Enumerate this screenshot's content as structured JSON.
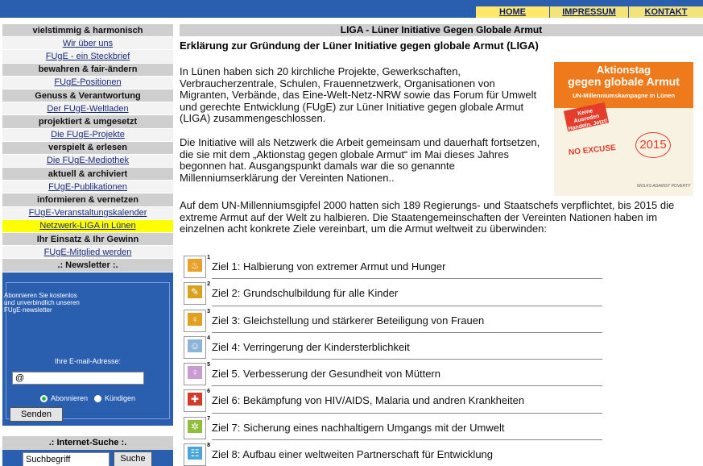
{
  "topnav": {
    "home": "HOME",
    "impressum": "IMPRESSUM",
    "kontakt": "KONTAKT"
  },
  "sidebar": {
    "items": [
      {
        "label": "vielstimmig & harmonisch",
        "kind": "category"
      },
      {
        "label": "Wir über uns",
        "kind": "link"
      },
      {
        "label": "FUgE - ein Steckbrief",
        "kind": "link"
      },
      {
        "label": "bewahren & fair-ändern",
        "kind": "category"
      },
      {
        "label": "FUgE-Positionen",
        "kind": "link"
      },
      {
        "label": "Genuss & Verantwortung",
        "kind": "category"
      },
      {
        "label": "Der FUgE-Weltladen",
        "kind": "link"
      },
      {
        "label": "projektiert & umgesetzt",
        "kind": "category"
      },
      {
        "label": "Die FUgE-Projekte",
        "kind": "link"
      },
      {
        "label": "verspielt & erlesen",
        "kind": "category"
      },
      {
        "label": "Die FUgE-Mediothek",
        "kind": "link"
      },
      {
        "label": "aktuell & archiviert",
        "kind": "category"
      },
      {
        "label": "FUgE-Publikationen",
        "kind": "link"
      },
      {
        "label": "informieren & vernetzen",
        "kind": "category"
      },
      {
        "label": "FUgE-Veranstaltungskalender",
        "kind": "link"
      },
      {
        "label": "Netzwerk-LIGA in Lünen",
        "kind": "active"
      },
      {
        "label": "Ihr Einsatz & Ihr Gewinn",
        "kind": "category"
      },
      {
        "label": "FUgE-Mitglied werden",
        "kind": "link"
      }
    ],
    "newsletter_heading": ".: Newsletter :.",
    "newsletter_intro": "Abonnieren Sie kostenlos\nund unverbindlich unseren\nFUgE-newsletter",
    "email_label": "Ihre E-mail-Adresse:",
    "email_value": "@",
    "radio_subscribe": "Abonnieren",
    "radio_unsubscribe": "Kündigen",
    "send_label": "Senden",
    "search_heading": ".: Internet-Suche :.",
    "search_value": "Suchbegriff",
    "search_button": "Suche"
  },
  "main": {
    "title": "LIGA - Lüner Initiative Gegen Globale Armut",
    "heading": "Erklärung zur Gründung der Lüner Initiative gegen globale Armut (LIGA)",
    "p1": "In Lünen haben sich 20 kirchliche Projekte, Gewerkschaften, Verbraucherzentrale, Schulen, Frauennetzwerk, Organisationen von Migranten, Verbände, das Eine-Welt-Netz-NRW sowie das Forum für Umwelt und gerechte Entwicklung (FUgE) zur Lüner Initiative gegen globale Armut (LIGA) zusammengeschlossen.",
    "p2": "Die Initiative will als Netzwerk die Arbeit gemeinsam und dauerhaft fortsetzen, die sie mit dem „Aktionstag gegen globale Armut“ im Mai dieses Jahres begonnen hat. Ausgangspunkt damals war die so genannte Millenniumserklärung der Vereinten Nationen..",
    "p3": "Auf dem UN-Millenniumsgipfel 2000 hatten sich 189 Regierungs- und Staatschefs verpflichtet, bis 2015 die extreme Armut auf der Welt zu halbieren. Die Staatengemeinschaften der Vereinten Nationen haben im einzelnen acht konkrete Ziele vereinbart, um die Armut weltweit zu überwinden:",
    "poster": {
      "line1": "Aktionstag",
      "line2": "gegen globale Armut",
      "line3": "UN-Millenniumskampagne in Lünen",
      "tag": "Keine Ausreden Handeln. Jetzt!",
      "excuse": "NO EXCUSE",
      "year": "2015",
      "footer": "WOLKS AGAINST POVERTY"
    },
    "goals": [
      {
        "text": "Ziel 1: Halbierung von extremer Armut und Hunger",
        "num": "1",
        "icon": "bowl-icon",
        "color": "#e8a22a"
      },
      {
        "text": "Ziel 2: Grundschulbildung für alle Kinder",
        "num": "2",
        "icon": "pencil-icon",
        "color": "#d9a21e"
      },
      {
        "text": "Ziel 3: Gleichstellung und stärkerer Beteiligung von Frauen",
        "num": "3",
        "icon": "female-icon",
        "color": "#e2a020"
      },
      {
        "text": "Ziel 4: Verringerung der Kindersterblichkeit",
        "num": "4",
        "icon": "child-icon",
        "color": "#8bb5d8"
      },
      {
        "text": "Ziel 5. Verbesserung der Gesundheit von Müttern",
        "num": "5",
        "icon": "mother-icon",
        "color": "#c99bd0"
      },
      {
        "text": "Ziel 6: Bekämpfung von HIV/AIDS, Malaria und andren Krankheiten",
        "num": "6",
        "icon": "medicine-icon",
        "color": "#d23a2a"
      },
      {
        "text": "Ziel 7: Sicherung eines nachhaltigern Umgangs mit der Umwelt",
        "num": "7",
        "icon": "tree-icon",
        "color": "#8fbf3a"
      },
      {
        "text": "Ziel 8: Aufbau einer weltweiten Partnerschaft für Entwicklung",
        "num": "8",
        "icon": "hands-icon",
        "color": "#4aa6d6"
      }
    ]
  }
}
